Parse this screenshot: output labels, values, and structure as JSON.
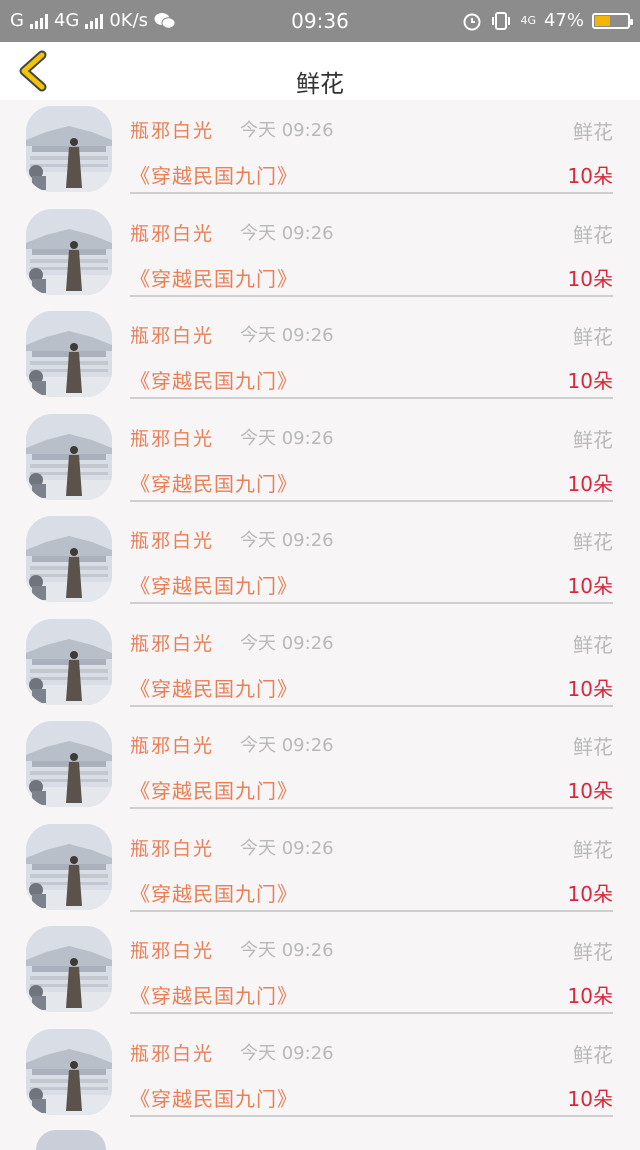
{
  "status_bar": {
    "carrier1": "G",
    "carrier2": "4G",
    "net_speed": "0K/s",
    "time": "09:36",
    "network_badge": "4G",
    "battery_percent": "47%",
    "battery_level": 0.47,
    "battery_color": "#f5b400",
    "icons": [
      "signal-icon",
      "wechat-icon",
      "alarm-icon",
      "vibrate-icon",
      "battery-icon"
    ]
  },
  "nav": {
    "back_icon": "chevron-left-icon",
    "back_color": "#f2c500",
    "title": "鲜花"
  },
  "items": [
    {
      "name": "瓶邪白光",
      "time": "今天 09:26",
      "type": "鲜花",
      "book": "《穿越民国九门》",
      "count": "10朵"
    },
    {
      "name": "瓶邪白光",
      "time": "今天 09:26",
      "type": "鲜花",
      "book": "《穿越民国九门》",
      "count": "10朵"
    },
    {
      "name": "瓶邪白光",
      "time": "今天 09:26",
      "type": "鲜花",
      "book": "《穿越民国九门》",
      "count": "10朵"
    },
    {
      "name": "瓶邪白光",
      "time": "今天 09:26",
      "type": "鲜花",
      "book": "《穿越民国九门》",
      "count": "10朵"
    },
    {
      "name": "瓶邪白光",
      "time": "今天 09:26",
      "type": "鲜花",
      "book": "《穿越民国九门》",
      "count": "10朵"
    },
    {
      "name": "瓶邪白光",
      "time": "今天 09:26",
      "type": "鲜花",
      "book": "《穿越民国九门》",
      "count": "10朵"
    },
    {
      "name": "瓶邪白光",
      "time": "今天 09:26",
      "type": "鲜花",
      "book": "《穿越民国九门》",
      "count": "10朵"
    },
    {
      "name": "瓶邪白光",
      "time": "今天 09:26",
      "type": "鲜花",
      "book": "《穿越民国九门》",
      "count": "10朵"
    },
    {
      "name": "瓶邪白光",
      "time": "今天 09:26",
      "type": "鲜花",
      "book": "《穿越民国九门》",
      "count": "10朵"
    },
    {
      "name": "瓶邪白光",
      "time": "今天 09:26",
      "type": "鲜花",
      "book": "《穿越民国九门》",
      "count": "10朵"
    }
  ],
  "colors": {
    "accent_orange": "#e87f57",
    "count_red": "#d6283c",
    "muted_gray": "#b9b9b9"
  }
}
